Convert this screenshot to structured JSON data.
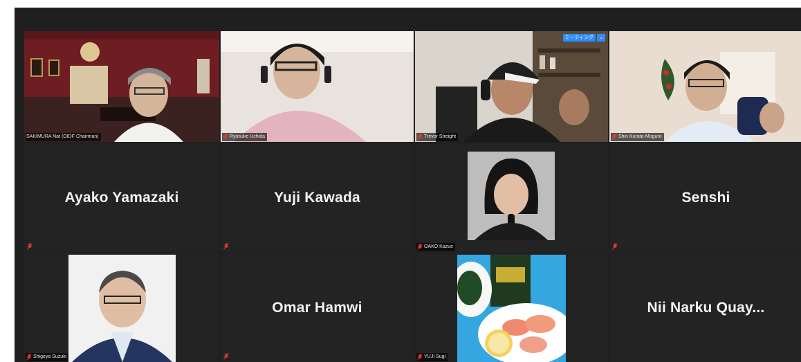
{
  "meeting": {
    "participants": [
      {
        "id": "p1",
        "display_name": "SAKIMURA Nat (OIDF Chairman)",
        "video": true,
        "active_speaker": true
      },
      {
        "id": "p2",
        "display_name": "Ryosuke Uchida",
        "video": true
      },
      {
        "id": "p3",
        "display_name": "Trevor Streight",
        "video": true,
        "overlay_button": "ミーティング",
        "overlay_menu": "⌄"
      },
      {
        "id": "p4",
        "display_name": "Shin Kurata-Moguro",
        "video": true
      },
      {
        "id": "p5",
        "display_name": "Ayako Yamazaki",
        "video": false
      },
      {
        "id": "p6",
        "display_name": "Yuji Kawada",
        "video": false
      },
      {
        "id": "p7",
        "display_name": "OAKO Kazue",
        "video": false,
        "profile_photo": true
      },
      {
        "id": "p8",
        "display_name": "Senshi",
        "video": false
      },
      {
        "id": "p9",
        "display_name": "Shigeya Suzuki",
        "video": false,
        "profile_photo": true
      },
      {
        "id": "p10",
        "display_name": "Omar Hamwi",
        "video": false
      },
      {
        "id": "p11",
        "display_name": "YUJI Sugi",
        "video": false,
        "profile_photo": true
      },
      {
        "id": "p12",
        "display_name": "Nii Narku Quay..."
      }
    ],
    "icons": {
      "muted": "microphone-muted-icon"
    },
    "colors": {
      "active_speaker_border": "#c6d86b",
      "tile_bg": "#232323",
      "muted_icon": "#e03c31"
    }
  }
}
